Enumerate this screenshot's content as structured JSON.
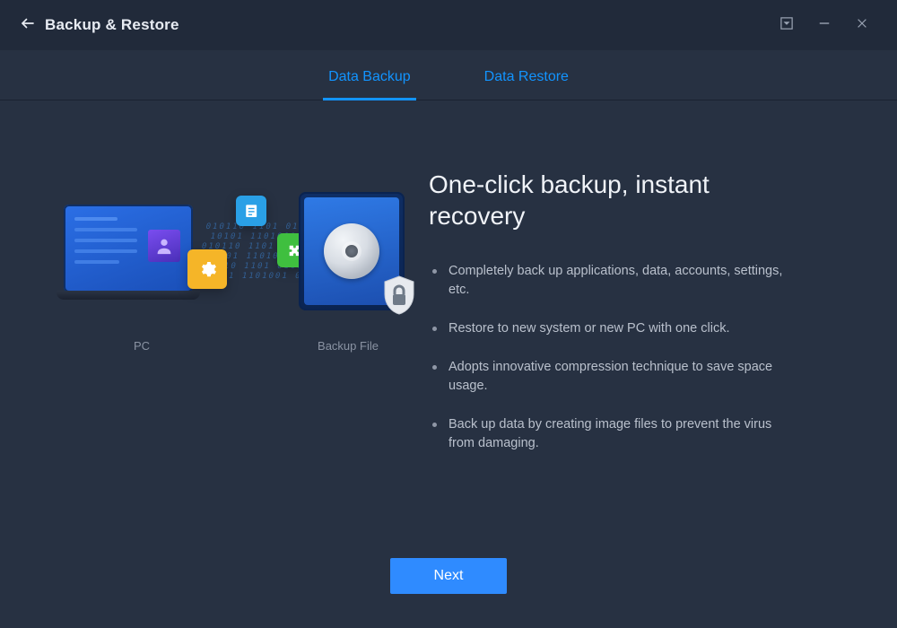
{
  "header": {
    "title": "Backup & Restore"
  },
  "tabs": {
    "backup": "Data Backup",
    "restore": "Data Restore"
  },
  "illustration": {
    "pc_label": "PC",
    "file_label": "Backup File"
  },
  "content": {
    "headline": "One-click backup, instant recovery",
    "features": [
      "Completely back up applications, data, accounts, settings, etc.",
      "Restore to new system or new PC with one click.",
      "Adopts innovative compression technique to save space usage.",
      "Back up data by creating image files to prevent the virus from damaging."
    ]
  },
  "actions": {
    "next": "Next"
  }
}
